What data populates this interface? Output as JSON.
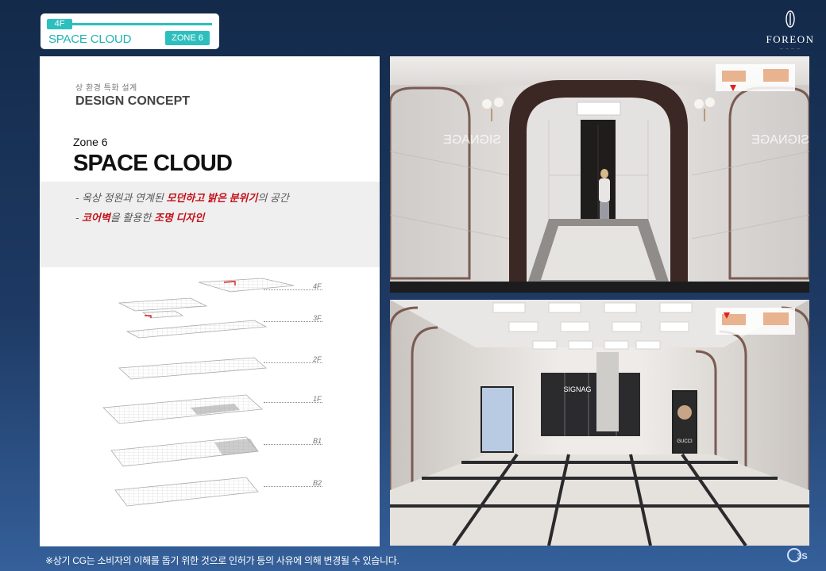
{
  "header": {
    "floor": "4F",
    "title": "SPACE CLOUD",
    "zone": "ZONE 6"
  },
  "brand": {
    "name": "FOREON",
    "sub": "— — — —"
  },
  "concept": {
    "kicker": "상 환경 특화 설계",
    "heading": "DESIGN CONCEPT",
    "zone_label": "Zone 6",
    "zone_title": "SPACE CLOUD",
    "bullet1": {
      "prefix": "- 옥상 정원과 연계된 ",
      "emphasis": "모던하고 밝은 분위기",
      "suffix": "의 공간"
    },
    "bullet2": {
      "prefix": "- ",
      "emphasis1": "코어벽",
      "middle": "을 활용한 ",
      "emphasis2": "조명 디자인"
    }
  },
  "floor_plan": {
    "labels": [
      "4F",
      "3F",
      "2F",
      "1F",
      "B1",
      "B2"
    ]
  },
  "photos": {
    "top": {
      "signage": "SIGNAGE"
    },
    "bottom": {
      "signage": "SIGNAG",
      "poster_brand": "GUCCI"
    }
  },
  "footnote": "※상기 CG는 소비자의 이해를 돕기 위한 것으로 인허가 등의 사유에 의해 변경될 수 있습니다.",
  "colors": {
    "accent_teal": "#2dbfbe",
    "emphasis_red": "#c4111a",
    "navy": "#132a4a"
  }
}
